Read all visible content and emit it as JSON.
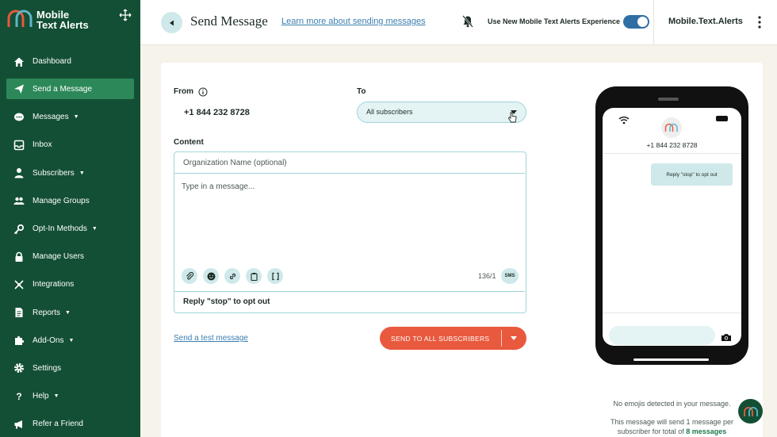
{
  "sidebar": {
    "brand_line1": "Mobile",
    "brand_line2": "Text Alerts",
    "items": [
      {
        "label": "Dashboard",
        "icon": "home-icon"
      },
      {
        "label": "Send a Message",
        "icon": "send-icon",
        "active": true
      },
      {
        "label": "Messages",
        "icon": "chat-icon",
        "has_caret": true
      },
      {
        "label": "Inbox",
        "icon": "inbox-icon"
      },
      {
        "label": "Subscribers",
        "icon": "user-icon",
        "has_caret": true
      },
      {
        "label": "Manage Groups",
        "icon": "group-icon"
      },
      {
        "label": "Opt-In Methods",
        "icon": "key-icon",
        "has_caret": true
      },
      {
        "label": "Manage Users",
        "icon": "lock-icon"
      },
      {
        "label": "Integrations",
        "icon": "integrations-icon"
      },
      {
        "label": "Reports",
        "icon": "report-icon",
        "has_caret": true
      },
      {
        "label": "Add-Ons",
        "icon": "puzzle-icon",
        "has_caret": true
      },
      {
        "label": "Settings",
        "icon": "gear-icon"
      },
      {
        "label": "Help",
        "icon": "help-icon",
        "has_caret": true
      },
      {
        "label": "Refer a Friend",
        "icon": "megaphone-icon"
      }
    ]
  },
  "header": {
    "title": "Send Message",
    "learn_link": "Learn more about sending messages",
    "toggle_label": "Use New Mobile Text Alerts Experience",
    "account_name": "Mobile.Text.Alerts"
  },
  "form": {
    "from_label": "From",
    "from_value": "+1 844 232 8728",
    "to_label": "To",
    "to_value": "All subscribers",
    "content_label": "Content",
    "org_placeholder": "Organization Name (optional)",
    "message_placeholder": "Type in a message...",
    "char_count": "136/1",
    "sms_badge": "SMS",
    "optout_text": "Reply \"stop\" to opt out",
    "test_link": "Send a test message",
    "send_button": "SEND TO ALL SUBSCRIBERS"
  },
  "preview": {
    "phone_number": "+1 844 232 8728",
    "bubble_text": "Reply \"stop\" to opt out",
    "emoji_note": "No emojis detected in your message.",
    "send_note_prefix": "This message will send 1 message per subscriber for total of",
    "send_note_total": "8 messages"
  },
  "colors": {
    "sidebar_bg": "#134f35",
    "active_item": "#2c8858",
    "accent_teal": "#cfe9ea",
    "send_button": "#e9593e",
    "link": "#3b7fb0"
  }
}
